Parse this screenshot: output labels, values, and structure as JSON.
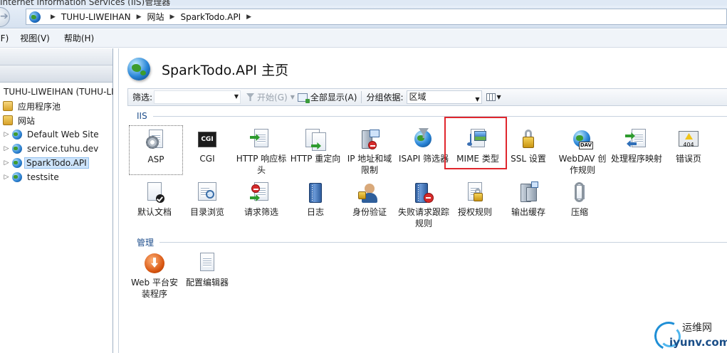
{
  "window": {
    "title": "Internet Information Services (IIS)管理器"
  },
  "address": {
    "breadcrumbs": [
      "TUHU-LIWEIHAN",
      "网站",
      "SparkTodo.API"
    ]
  },
  "menu": {
    "items": [
      "(F)",
      "视图(V)",
      "帮助(H)"
    ]
  },
  "tree": {
    "root": "TUHU-LIWEIHAN (TUHU-LI",
    "app_pools": "应用程序池",
    "sites": "网站",
    "site_items": [
      "Default Web Site",
      "service.tuhu.dev",
      "SparkTodo.API",
      "testsite"
    ],
    "selected": "SparkTodo.API"
  },
  "main": {
    "title": "SparkTodo.API 主页",
    "filter": {
      "label": "筛选:",
      "start": "开始(G)",
      "show_all": "全部显示(A)",
      "group_label": "分组依据:",
      "group_value": "区域"
    },
    "groups": {
      "iis": "IIS",
      "manage": "管理"
    },
    "iis_features": [
      "ASP",
      "CGI",
      "HTTP 响应标头",
      "HTTP 重定向",
      "IP 地址和域限制",
      "ISAPI 筛选器",
      "MIME 类型",
      "SSL 设置",
      "WebDAV 创作规则",
      "处理程序映射",
      "错误页",
      "默认文档",
      "目录浏览",
      "请求筛选",
      "日志",
      "身份验证",
      "失败请求跟踪规则",
      "授权规则",
      "输出缓存",
      "压缩"
    ],
    "manage_features": [
      "Web 平台安装程序",
      "配置编辑器"
    ],
    "icon_text": {
      "cgi": "CGI",
      "err": "404",
      "dav": "DAV"
    }
  },
  "watermark": {
    "cn": "运维网",
    "en": "iyunv.com"
  },
  "colors": {
    "highlight": "#e0262d",
    "group_title": "#1e4e8c",
    "selection": "#cde4fb"
  }
}
